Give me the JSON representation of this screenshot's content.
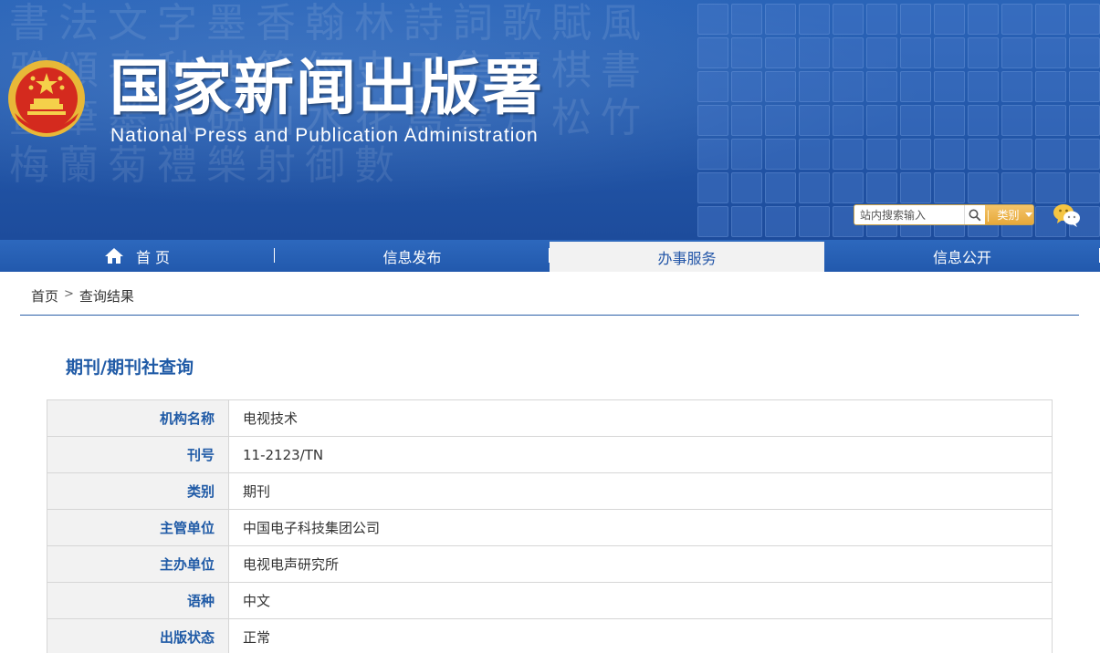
{
  "header": {
    "title": "国家新闻出版署",
    "subtitle": "National  Press and Publication Administration",
    "search": {
      "placeholder": "站内搜索输入",
      "category_label": "类别"
    }
  },
  "nav": {
    "items": [
      {
        "label": "首 页",
        "icon": "home-icon"
      },
      {
        "label": "信息发布"
      },
      {
        "label": "办事服务",
        "active": true
      },
      {
        "label": "信息公开"
      }
    ]
  },
  "breadcrumb": {
    "home": "首页",
    "separator": ">",
    "current": "查询结果"
  },
  "main": {
    "section_title": "期刊/期刊社查询",
    "rows": [
      {
        "key": "机构名称",
        "value": "电视技术"
      },
      {
        "key": "刊号",
        "value": "11-2123/TN"
      },
      {
        "key": "类别",
        "value": "期刊"
      },
      {
        "key": "主管单位",
        "value": "中国电子科技集团公司"
      },
      {
        "key": "主办单位",
        "value": "电视电声研究所"
      },
      {
        "key": "语种",
        "value": "中文"
      },
      {
        "key": "出版状态",
        "value": "正常"
      }
    ]
  },
  "colors": {
    "accent": "#1f5aa6",
    "nav": "#2a63b6",
    "category": "#e6a83a"
  }
}
